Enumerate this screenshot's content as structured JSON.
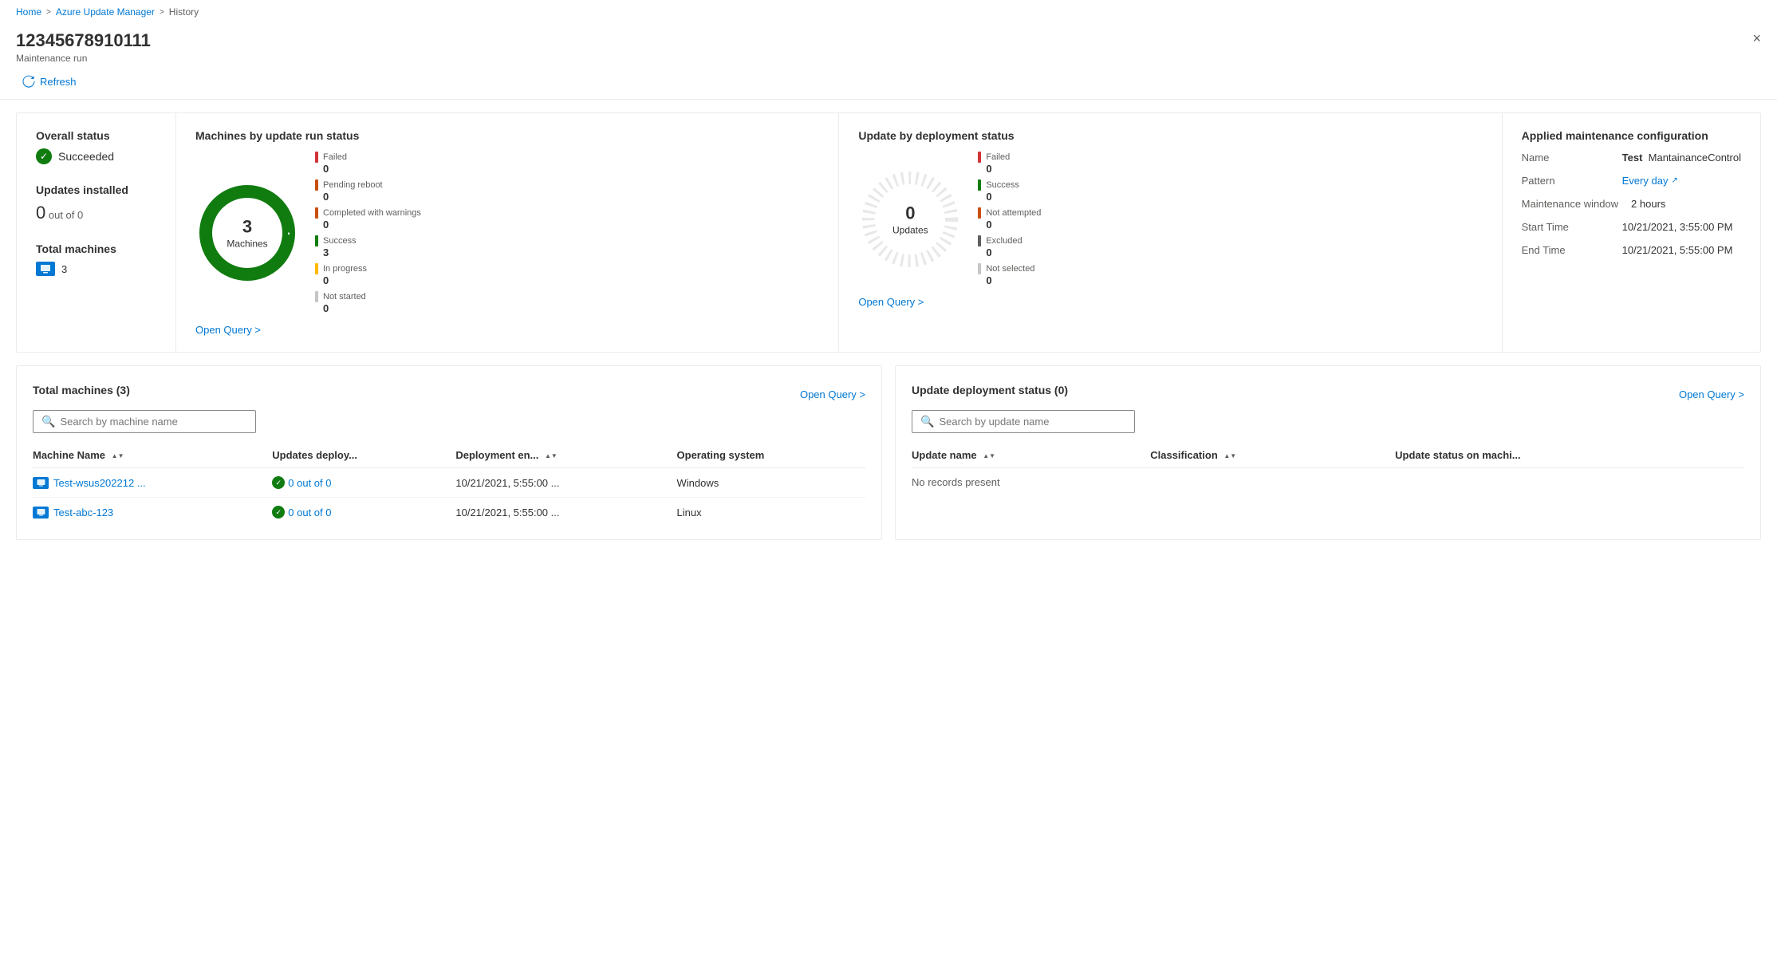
{
  "breadcrumb": {
    "home": "Home",
    "azure_update_manager": "Azure Update Manager",
    "history": "History",
    "sep": ">"
  },
  "header": {
    "title": "12345678910111",
    "subtitle": "Maintenance run",
    "close_label": "×"
  },
  "toolbar": {
    "refresh_label": "Refresh"
  },
  "page_title": "Azure Update Manager History",
  "summary": {
    "overall_status_label": "Overall status",
    "status_value": "Succeeded",
    "updates_installed_label": "Updates installed",
    "updates_count": "0",
    "updates_out_of": "out of 0",
    "total_machines_label": "Total machines",
    "machines_count": "3"
  },
  "machines_chart": {
    "title": "Machines by update run status",
    "center_number": "3",
    "center_label": "Machines",
    "open_query": "Open Query >",
    "legend": [
      {
        "label": "Failed",
        "value": "0",
        "color": "#d13438"
      },
      {
        "label": "Pending reboot",
        "value": "0",
        "color": "#ca5010"
      },
      {
        "label": "Completed with warnings",
        "value": "0",
        "color": "#ca5010"
      },
      {
        "label": "Success",
        "value": "3",
        "color": "#107c10"
      },
      {
        "label": "In progress",
        "value": "0",
        "color": "#ffb900"
      },
      {
        "label": "Not started",
        "value": "0",
        "color": "#c8c6c4"
      }
    ]
  },
  "updates_chart": {
    "title": "Update by deployment status",
    "center_number": "0",
    "center_label": "Updates",
    "open_query": "Open Query >",
    "legend": [
      {
        "label": "Failed",
        "value": "0",
        "color": "#d13438"
      },
      {
        "label": "Success",
        "value": "0",
        "color": "#107c10"
      },
      {
        "label": "Not attempted",
        "value": "0",
        "color": "#ca5010"
      },
      {
        "label": "Excluded",
        "value": "0",
        "color": "#605e5c"
      },
      {
        "label": "Not selected",
        "value": "0",
        "color": "#c8c6c4"
      }
    ]
  },
  "config_panel": {
    "title": "Applied maintenance configuration",
    "name_label": "Name",
    "name_value": "Test",
    "name_value2": "MantainanceControl",
    "pattern_label": "Pattern",
    "pattern_value": "Every day",
    "maintenance_window_label": "Maintenance window",
    "maintenance_window_value": "2 hours",
    "start_time_label": "Start Time",
    "start_time_value": "10/21/2021, 3:55:00 PM",
    "end_time_label": "End Time",
    "end_time_value": "10/21/2021, 5:55:00 PM"
  },
  "machines_table": {
    "title": "Total machines (3)",
    "open_query": "Open Query >",
    "search_placeholder": "Search by machine name",
    "columns": [
      {
        "label": "Machine Name",
        "sortable": true
      },
      {
        "label": "Updates deploy...",
        "sortable": false
      },
      {
        "label": "Deployment en...",
        "sortable": true
      },
      {
        "label": "Operating system",
        "sortable": false
      }
    ],
    "rows": [
      {
        "machine_name": "Test-wsus202212 ...",
        "updates_deploy": "0 out of 0",
        "deployment_end": "10/21/2021, 5:55:00 ...",
        "os": "Windows"
      },
      {
        "machine_name": "Test-abc-123",
        "updates_deploy": "0 out of 0",
        "deployment_end": "10/21/2021, 5:55:00 ...",
        "os": "Linux"
      }
    ]
  },
  "updates_table": {
    "title": "Update deployment status (0)",
    "open_query": "Open Query >",
    "search_placeholder": "Search by update name",
    "columns": [
      {
        "label": "Update name",
        "sortable": true
      },
      {
        "label": "Classification",
        "sortable": true
      },
      {
        "label": "Update status on machi...",
        "sortable": false
      }
    ],
    "no_records": "No records present"
  }
}
